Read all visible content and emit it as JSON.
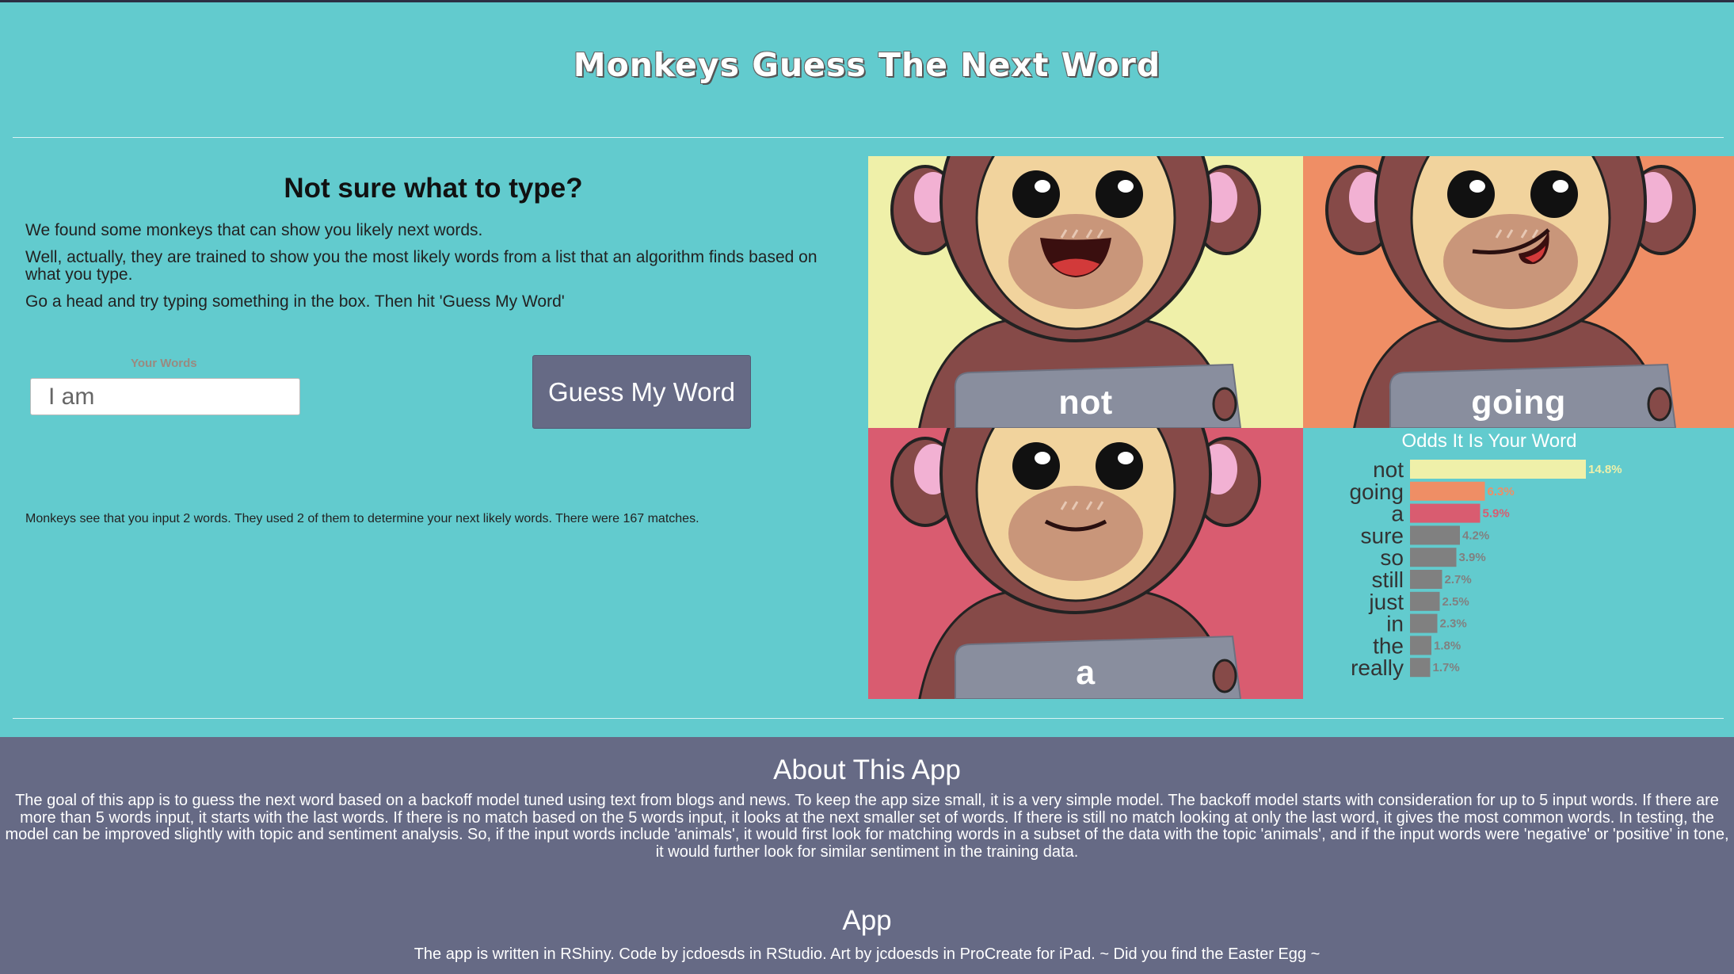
{
  "app": {
    "title": "Monkeys Guess The Next Word"
  },
  "intro": {
    "heading": "Not sure what to type?",
    "paragraphs": [
      "We found some monkeys that can show you likely next words.",
      "Well, actually, they are trained to show you the most likely words from a list that an algorithm finds based on what you type.",
      "Go a head and try typing something in the box. Then hit 'Guess My Word'"
    ]
  },
  "form": {
    "input_label": "Your Words",
    "input_value": "I am",
    "guess_button": "Guess My Word"
  },
  "status": "Monkeys see that you input 2 words. They used 2 of them to determine your next likely words. There were 167 matches.",
  "monkeys": [
    {
      "word": "not",
      "bg": "#eff0a9"
    },
    {
      "word": "going",
      "bg": "#ef8e65"
    },
    {
      "word": "a",
      "bg": "#d95c70"
    }
  ],
  "chart_data": {
    "type": "bar",
    "orientation": "horizontal",
    "title": "Odds It Is Your Word",
    "categories": [
      "not",
      "going",
      "a",
      "sure",
      "so",
      "still",
      "just",
      "in",
      "the",
      "really"
    ],
    "values": [
      14.8,
      6.3,
      5.9,
      4.2,
      3.9,
      2.7,
      2.5,
      2.3,
      1.8,
      1.7
    ],
    "value_labels": [
      "14.8%",
      "6.3%",
      "5.9%",
      "4.2%",
      "3.9%",
      "2.7%",
      "2.5%",
      "2.3%",
      "1.8%",
      "1.7%"
    ],
    "bar_colors": [
      "#eff0a9",
      "#ef8e65",
      "#d95c70",
      "#808080",
      "#808080",
      "#808080",
      "#808080",
      "#808080",
      "#808080",
      "#808080"
    ],
    "xlim": [
      0,
      20
    ]
  },
  "about": {
    "heading": "About This App",
    "text": "The goal of this app is to guess the next word based on a backoff model tuned using text from blogs and news. To keep the app size small, it is a very simple model. The backoff model starts with consideration for up to 5 input words. If there are more than 5 words input, it starts with the last words. If there is no match based on the 5 words input, it looks at the next smaller set of words. If there is still no match looking at only the last word, it gives the most common words. In testing, the model can be improved slightly with topic and sentiment analysis. So, if the input words include 'animals', it would first look for matching words in a subset of the data with the topic 'animals', and if the input words were 'negative' or 'positive' in tone, it would further look for similar sentiment in the training data.",
    "app_heading": "App",
    "app_text": "The app is written in RShiny. Code by jcdoesds in RStudio. Art by jcdoesds in ProCreate for iPad. ~ Did you find the Easter Egg ~"
  }
}
